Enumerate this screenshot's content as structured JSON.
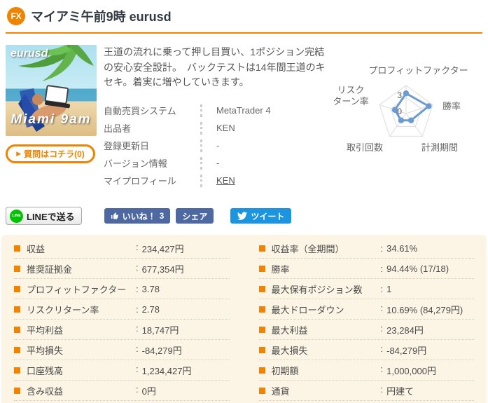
{
  "colors": {
    "accent": "#f08300",
    "panel_bg": "#fcf5e6",
    "radar_blue": "#6c9bd2",
    "facebook_blue": "#4e69a2",
    "twitter_blue": "#1b95e0",
    "line_green": "#00c300",
    "row_divider": "#d5c9b2"
  },
  "header": {
    "badge_text": "FX",
    "title": "マイアミ午前9時 eurusd"
  },
  "product": {
    "image_text_top": "eurusd",
    "image_text_bottom": "Miami 9am",
    "question_button_arrow": "▶",
    "question_button_label": "質問はコチラ(0)"
  },
  "description": "王道の流れに乗って押し目買い、1ポジション完結の安心安全設計。　バックテストは14年間王道のキセキ。着実に増やしていきます。",
  "details": {
    "rows": [
      {
        "label": "自動売買システム",
        "value": "MetaTrader 4"
      },
      {
        "label": "出品者",
        "value": "KEN"
      },
      {
        "label": "登録更新日",
        "value": "-"
      },
      {
        "label": "バージョン情報",
        "value": "-"
      },
      {
        "label": "マイプロフィール",
        "value": "KEN"
      }
    ]
  },
  "chart_data": {
    "type": "radar",
    "axes": [
      "プロフィットファクター",
      "勝率",
      "計測期間",
      "取引回数",
      "リスク\nターン率"
    ],
    "normalized_values": [
      0.72,
      0.85,
      0.3,
      0.3,
      0.42
    ],
    "scale": {
      "ticks": [
        {
          "label": "3",
          "fraction": 0.57
        },
        {
          "label": "0",
          "fraction": 0
        }
      ]
    },
    "grid": true,
    "series_color": "#6c9bd2"
  },
  "social": {
    "line_icon_text": "LINE",
    "line_label": "LINEで送る",
    "like_label": "いいね！",
    "like_count": "3",
    "share_label": "シェア",
    "tweet_label": "ツイート"
  },
  "stats": {
    "colon": ":",
    "left": [
      {
        "label": "収益",
        "value": "234,427円"
      },
      {
        "label": "推奨証拠金",
        "value": "677,354円"
      },
      {
        "label": "プロフィットファクター",
        "value": "3.78"
      },
      {
        "label": "リスクリターン率",
        "value": "2.78"
      },
      {
        "label": "平均利益",
        "value": "18,747円"
      },
      {
        "label": "平均損失",
        "value": "-84,279円"
      },
      {
        "label": "口座残高",
        "value": "1,234,427円"
      },
      {
        "label": "含み収益",
        "value": "0円"
      }
    ],
    "right": [
      {
        "label": "収益率（全期間）",
        "value": "34.61%"
      },
      {
        "label": "勝率",
        "value": "94.44% (17/18)"
      },
      {
        "label": "最大保有ポジション数",
        "value": "1"
      },
      {
        "label": "最大ドローダウン",
        "value": "10.69% (84,279円)"
      },
      {
        "label": "最大利益",
        "value": "23,284円"
      },
      {
        "label": "最大損失",
        "value": "-84,279円"
      },
      {
        "label": "初期額",
        "value": "1,000,000円"
      },
      {
        "label": "通貨",
        "value": "円建て"
      }
    ]
  }
}
